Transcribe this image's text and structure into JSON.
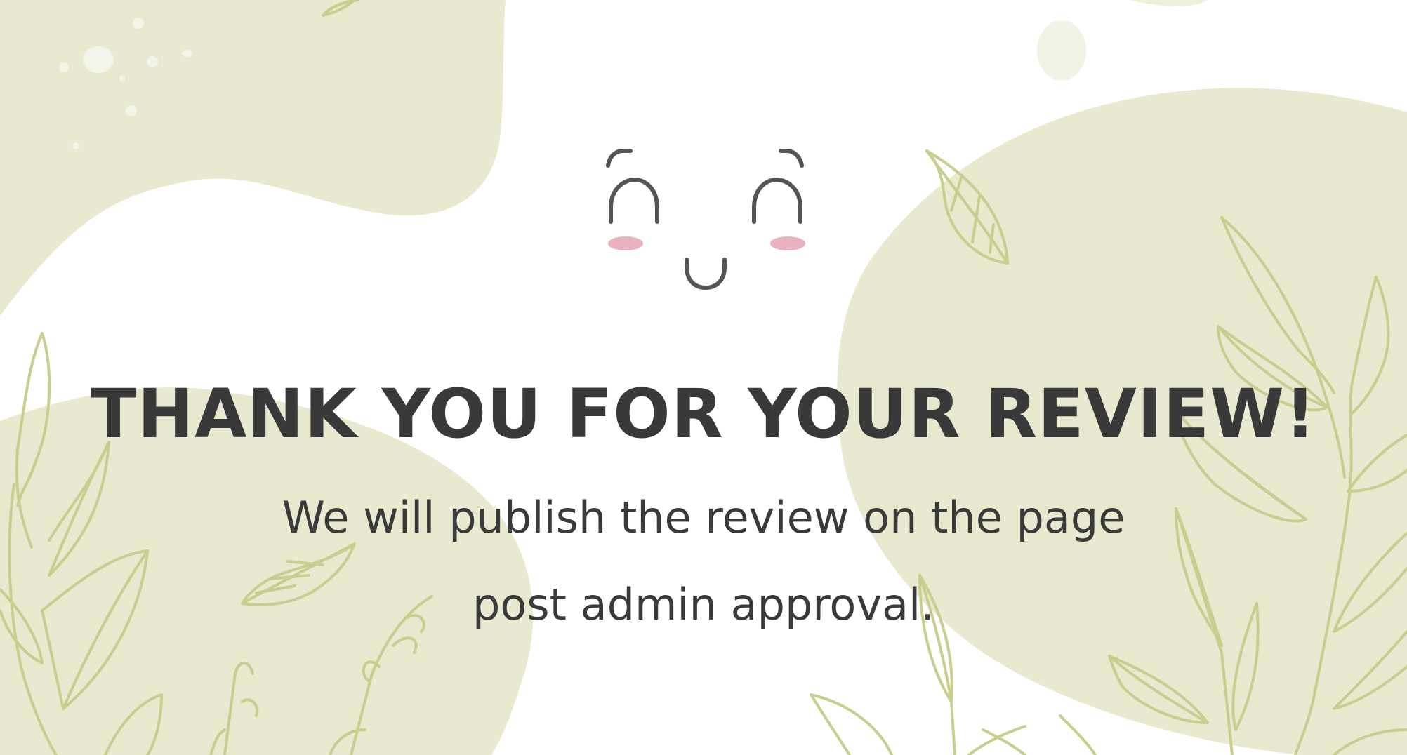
{
  "message": {
    "title": "THANK YOU FOR YOUR REVIEW!",
    "line1": "We will publish the review on the page",
    "line2": "post admin approval."
  },
  "colors": {
    "background": "#ffffff",
    "blob": "#e8e9cf",
    "leaf_stroke": "#c9ce8f",
    "text": "#393939",
    "face_stroke": "#555555",
    "blush": "#eab2c0"
  },
  "icons": {
    "face": "smiling-face-icon"
  }
}
